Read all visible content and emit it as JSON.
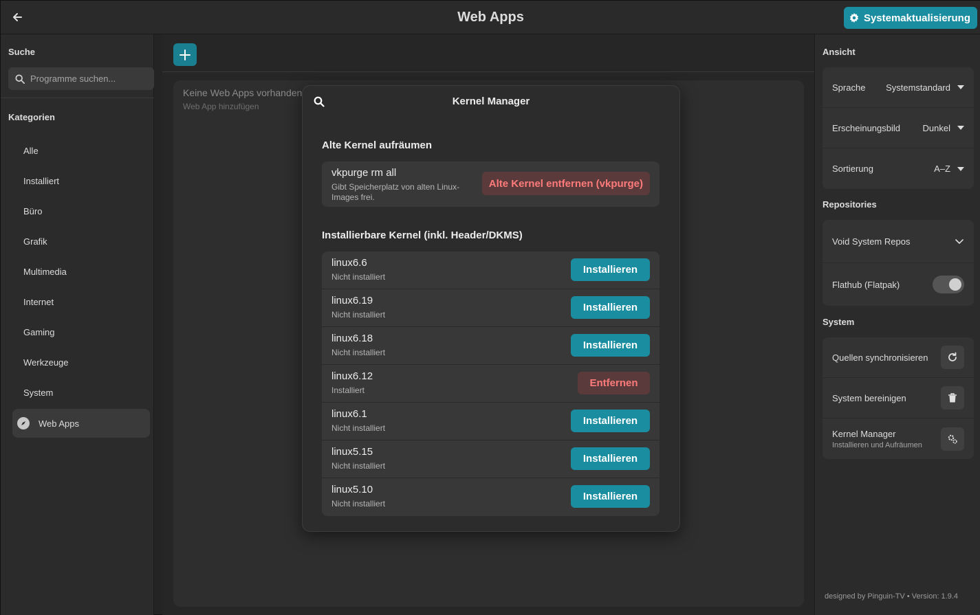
{
  "header": {
    "title": "Web Apps",
    "system_update_label": "Systemaktualisierung"
  },
  "sidebar_left": {
    "search_heading": "Suche",
    "search_placeholder": "Programme suchen...",
    "categories_heading": "Kategorien",
    "categories": [
      {
        "label": "Alle"
      },
      {
        "label": "Installiert"
      },
      {
        "label": "Büro"
      },
      {
        "label": "Grafik"
      },
      {
        "label": "Multimedia"
      },
      {
        "label": "Internet"
      },
      {
        "label": "Gaming"
      },
      {
        "label": "Werkzeuge"
      },
      {
        "label": "System"
      }
    ],
    "active_category": "Web Apps"
  },
  "main": {
    "empty_title": "Keine Web Apps vorhanden",
    "empty_subtitle": "Web App hinzufügen"
  },
  "sidebar_right": {
    "view_heading": "Ansicht",
    "language_label": "Sprache",
    "language_value": "Systemstandard",
    "appearance_label": "Erscheinungsbild",
    "appearance_value": "Dunkel",
    "sort_label": "Sortierung",
    "sort_value": "A–Z",
    "repos_heading": "Repositories",
    "void_repos_label": "Void System Repos",
    "flathub_label": "Flathub (Flatpak)",
    "flathub_enabled": false,
    "system_heading": "System",
    "sync_label": "Quellen synchronisieren",
    "clean_label": "System bereinigen",
    "kernel_label": "Kernel Manager",
    "kernel_sub": "Installieren und Aufräumen",
    "footer": "designed by Pinguin-TV  •  Version: 1.9.4"
  },
  "modal": {
    "title": "Kernel Manager",
    "cleanup_heading": "Alte Kernel aufräumen",
    "vkpurge_name": "vkpurge rm all",
    "vkpurge_desc": "Gibt Speicherplatz von alten Linux-Images frei.",
    "vkpurge_button": "Alte Kernel entfernen (vkpurge)",
    "installable_heading": "Installierbare Kernel (inkl. Header/DKMS)",
    "kernels": [
      {
        "name": "linux6.6",
        "status": "Nicht installiert",
        "action": "Installieren"
      },
      {
        "name": "linux6.19",
        "status": "Nicht installiert",
        "action": "Installieren"
      },
      {
        "name": "linux6.18",
        "status": "Nicht installiert",
        "action": "Installieren"
      },
      {
        "name": "linux6.12",
        "status": "Installiert",
        "action": "Entfernen"
      },
      {
        "name": "linux6.1",
        "status": "Nicht installiert",
        "action": "Installieren"
      },
      {
        "name": "linux5.15",
        "status": "Nicht installiert",
        "action": "Installieren"
      },
      {
        "name": "linux5.10",
        "status": "Nicht installiert",
        "action": "Installieren"
      }
    ]
  }
}
